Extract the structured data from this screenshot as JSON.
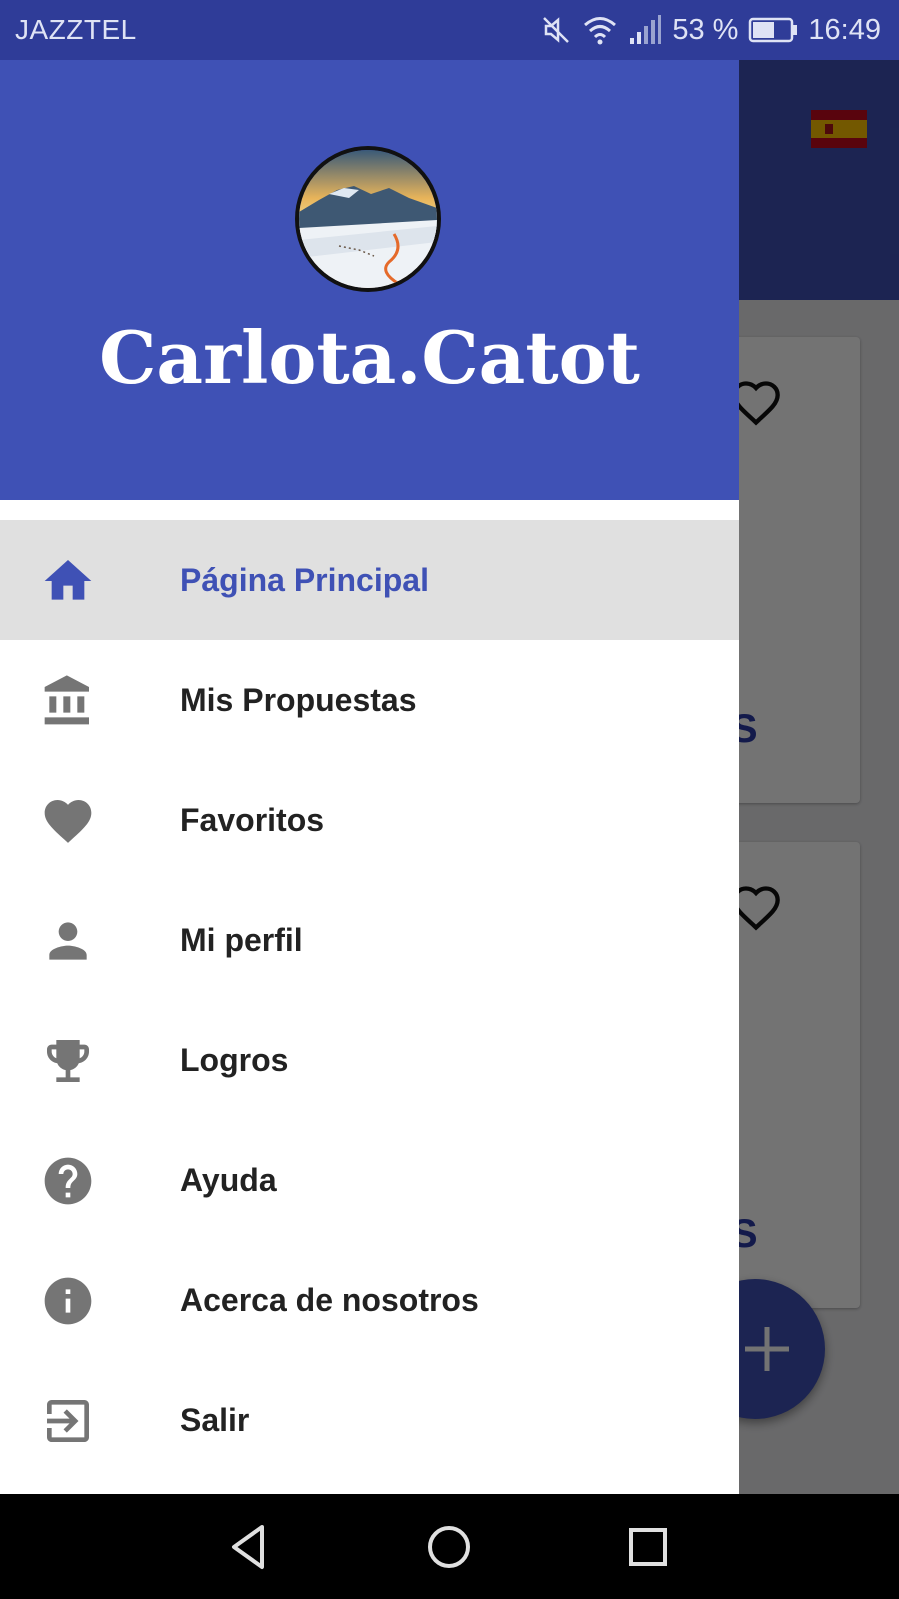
{
  "status_bar": {
    "carrier": "JAZZTEL",
    "battery": "53 %",
    "time": "16:49",
    "icons": [
      "mute-icon",
      "wifi-icon",
      "signal-icon",
      "battery-icon"
    ]
  },
  "background_app": {
    "card_button_label": "ÁS",
    "flag": "spain-flag-icon",
    "fab_icon": "plus-icon"
  },
  "drawer": {
    "username": "Carlota.Catot",
    "avatar": "profile-avatar-mountain",
    "items": [
      {
        "label": "Página Principal",
        "icon": "home-icon",
        "active": true
      },
      {
        "label": "Mis Propuestas",
        "icon": "institution-icon",
        "active": false
      },
      {
        "label": "Favoritos",
        "icon": "heart-icon",
        "active": false
      },
      {
        "label": "Mi perfil",
        "icon": "person-icon",
        "active": false
      },
      {
        "label": "Logros",
        "icon": "trophy-icon",
        "active": false
      },
      {
        "label": "Ayuda",
        "icon": "help-icon",
        "active": false
      },
      {
        "label": "Acerca de nosotros",
        "icon": "info-icon",
        "active": false
      },
      {
        "label": "Salir",
        "icon": "exit-icon",
        "active": false
      }
    ]
  },
  "colors": {
    "primary": "#3f51b5",
    "status_bar": "#2f3c98",
    "active_item_bg": "#e0e0e0",
    "icon_gray": "#757575"
  }
}
